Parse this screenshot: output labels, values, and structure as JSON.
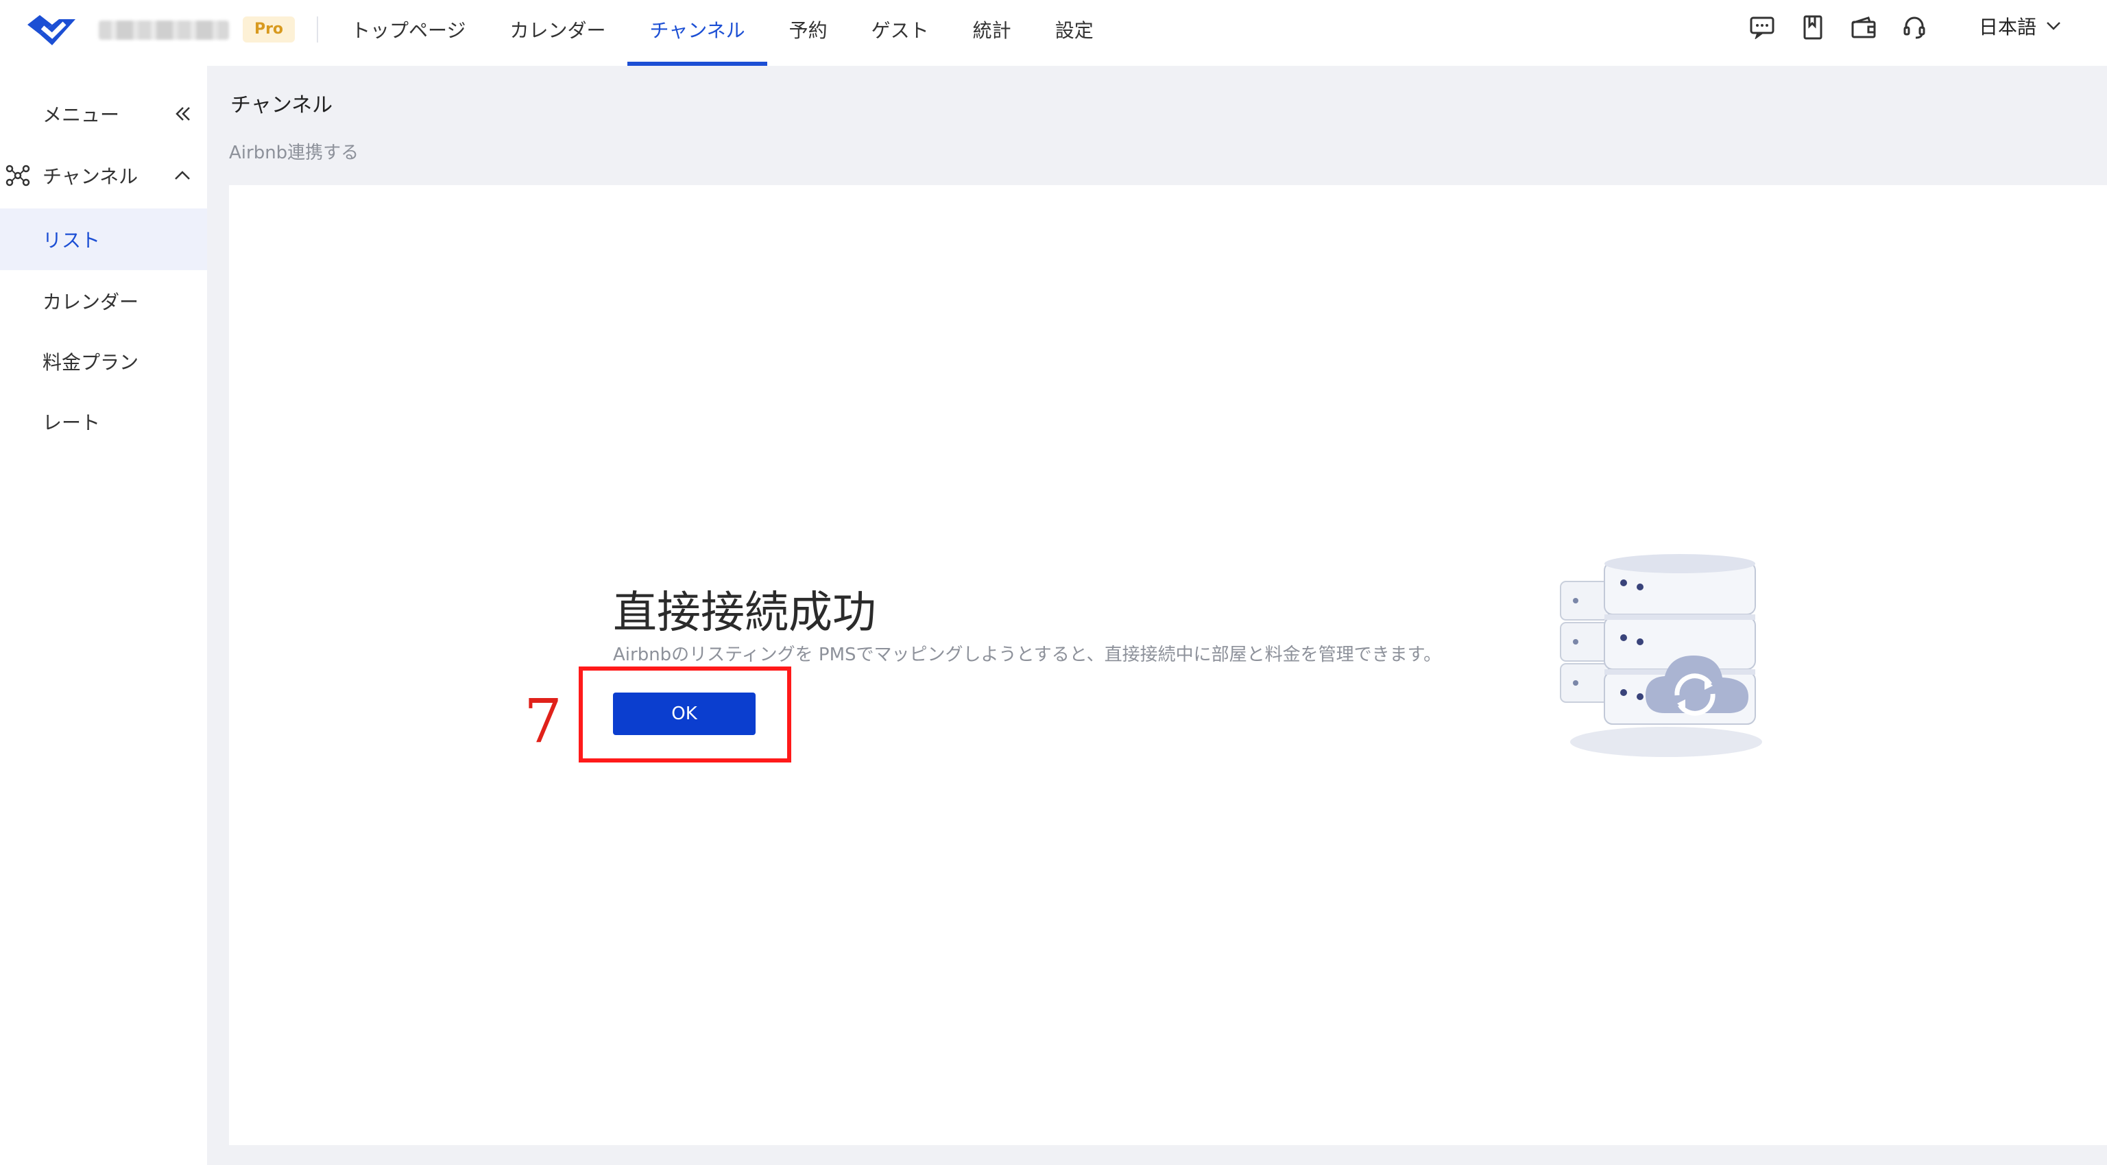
{
  "header": {
    "plan_badge": "Pro",
    "nav": [
      {
        "label": "トップページ",
        "active": false
      },
      {
        "label": "カレンダー",
        "active": false
      },
      {
        "label": "チャンネル",
        "active": true
      },
      {
        "label": "予約",
        "active": false
      },
      {
        "label": "ゲスト",
        "active": false
      },
      {
        "label": "統計",
        "active": false
      },
      {
        "label": "設定",
        "active": false
      }
    ],
    "icons": [
      "message-icon",
      "bookmark-icon",
      "wallet-icon",
      "headset-icon"
    ],
    "language": "日本語"
  },
  "sidebar": {
    "menu_label": "メニュー",
    "group_label": "チャンネル",
    "items": [
      {
        "label": "リスト",
        "active": true
      },
      {
        "label": "カレンダー",
        "active": false
      },
      {
        "label": "料金プラン",
        "active": false
      },
      {
        "label": "レート",
        "active": false
      }
    ]
  },
  "main": {
    "title": "チャンネル",
    "breadcrumb": "Airbnb連携する",
    "result": {
      "title": "直接接続成功",
      "description": "Airbnbのリスティングを PMSでマッピングしようとすると、直接接続中に部屋と料金を管理できます。",
      "ok_label": "OK"
    }
  },
  "annotation": {
    "step_number": "7"
  },
  "colors": {
    "accent": "#1c4fd4",
    "button": "#0b3ecf",
    "annotation": "#ff1a1a",
    "badge_bg": "#fdf1d6",
    "badge_text": "#d89a1f"
  }
}
